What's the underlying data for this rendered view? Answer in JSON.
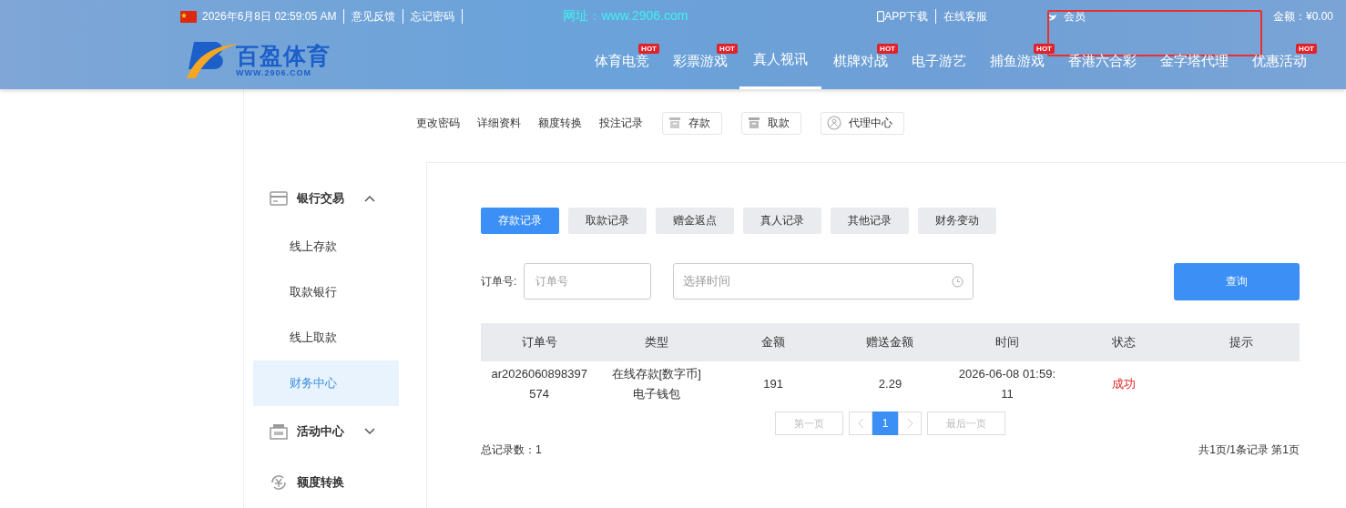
{
  "topbar": {
    "datetime": "2026年6月8日 02:59:05 AM",
    "links": [
      "意见反馈",
      "忘记密码"
    ],
    "site": "网址：www.2906.com",
    "right_links": [
      "APP下载",
      "在线客服"
    ],
    "member": "会员",
    "balance": "金额：¥0.00"
  },
  "logo": {
    "name": "百盈体育",
    "url": "WWW.2906.COM"
  },
  "nav": [
    {
      "label": "体育电竞",
      "badge": "HOT",
      "selected": false
    },
    {
      "label": "彩票游戏",
      "badge": "HOT",
      "selected": false
    },
    {
      "label": "真人视讯",
      "selected": true
    },
    {
      "label": "棋牌对战",
      "badge": "HOT",
      "selected": false
    },
    {
      "label": "电子游艺",
      "selected": false
    },
    {
      "label": "捕鱼游戏",
      "badge": "HOT",
      "selected": false
    },
    {
      "label": "香港六合彩",
      "selected": false
    },
    {
      "label": "金字塔代理",
      "selected": false
    },
    {
      "label": "优惠活动",
      "badge": "HOT",
      "selected": false
    }
  ],
  "account_links": [
    {
      "label": "更改密码",
      "kind": "text"
    },
    {
      "label": "详细资料",
      "kind": "text"
    },
    {
      "label": "额度转换",
      "kind": "text"
    },
    {
      "label": "投注记录",
      "kind": "text"
    },
    {
      "label": "存款",
      "kind": "deposit"
    },
    {
      "label": "取款",
      "kind": "withdraw"
    },
    {
      "label": "代理中心",
      "kind": "agent"
    }
  ],
  "sidebar": [
    {
      "label": "银行交易",
      "kind": "card",
      "expanded": true,
      "children": [
        {
          "label": "线上存款",
          "selected": false
        },
        {
          "label": "取款银行",
          "selected": false
        },
        {
          "label": "线上取款",
          "selected": false
        },
        {
          "label": "财务中心",
          "selected": true
        }
      ]
    },
    {
      "label": "活动中心",
      "kind": "gift",
      "expanded": false
    },
    {
      "label": "额度转换",
      "kind": "exchange"
    }
  ],
  "tabs": [
    {
      "label": "存款记录",
      "selected": true
    },
    {
      "label": "取款记录",
      "selected": false
    },
    {
      "label": "赠金返点",
      "selected": false
    },
    {
      "label": "真人记录",
      "selected": false
    },
    {
      "label": "其他记录",
      "selected": false
    },
    {
      "label": "财务变动",
      "selected": false
    }
  ],
  "filter": {
    "label": "订单号:",
    "order_placeholder": "订单号",
    "time_placeholder": "选择时间",
    "button": "查询"
  },
  "table": {
    "columns": [
      "订单号",
      "类型",
      "金额",
      "赠送金额",
      "时间",
      "状态",
      "提示"
    ],
    "rows": [
      {
        "cells": [
          "ar2026060898397574",
          "在线存款[数字币]电子钱包",
          "191",
          "2.29",
          "2026-06-08 01:59:11",
          "成功",
          ""
        ],
        "kind": "success"
      }
    ]
  },
  "pagination": {
    "first": "第一页",
    "pages": [
      {
        "label": "1",
        "selected": true
      }
    ],
    "last": "最后一页"
  },
  "footer": {
    "total": "总记录数：1",
    "summary": "共1页/1条记录 第1页"
  }
}
